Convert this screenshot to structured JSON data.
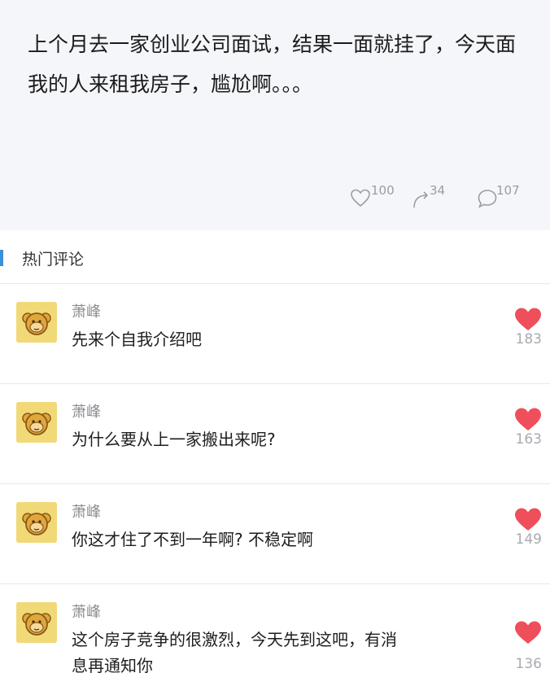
{
  "post": {
    "text": "上个月去一家创业公司面试，结果一面就挂了，今天面我的人来租我房子，尴尬啊。。。",
    "stats": {
      "likes": "100",
      "shares": "34",
      "comments": "107"
    }
  },
  "section": {
    "title": "热门评论"
  },
  "colors": {
    "heart": "#ef4f5a",
    "accent_bar": "#3d8fd6",
    "avatar_bg": "#f2d978"
  },
  "comments": [
    {
      "name": "萧峰",
      "text": "先来个自我介绍吧",
      "likes": "183"
    },
    {
      "name": "萧峰",
      "text": "为什么要从上一家搬出来呢?",
      "likes": "163"
    },
    {
      "name": "萧峰",
      "text": "你这才住了不到一年啊? 不稳定啊",
      "likes": "149"
    },
    {
      "name": "萧峰",
      "text": "这个房子竞争的很激烈，今天先到这吧，有消息再通知你",
      "likes": "136"
    }
  ]
}
